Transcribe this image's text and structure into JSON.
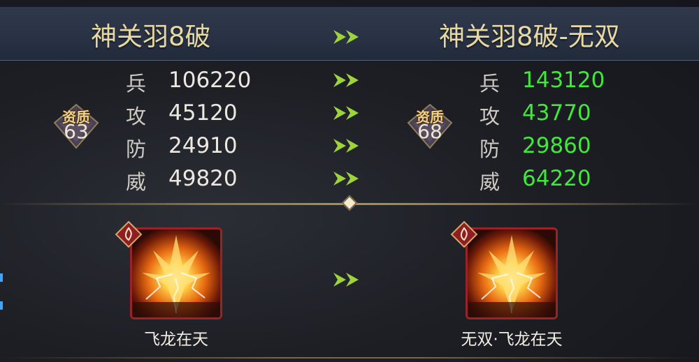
{
  "header": {
    "left_title": "神关羽8破",
    "right_title": "神关羽8破-无双"
  },
  "stats": {
    "labels": [
      "兵",
      "攻",
      "防",
      "威"
    ],
    "left_values": [
      "106220",
      "45120",
      "24910",
      "49820"
    ],
    "right_values": [
      "143120",
      "43770",
      "29860",
      "64220"
    ]
  },
  "quality": {
    "label": "资质",
    "left_value": "63",
    "right_value": "68"
  },
  "skill": {
    "left_name": "飞龙在天",
    "right_name": "无双·飞龙在天",
    "badge_icon": "flame-icon"
  },
  "colors": {
    "title_gold": "#e8d9a3",
    "upgrade_green": "#40e83a",
    "arrow_green": "#9ed33a",
    "skill_border": "#9a2328"
  }
}
